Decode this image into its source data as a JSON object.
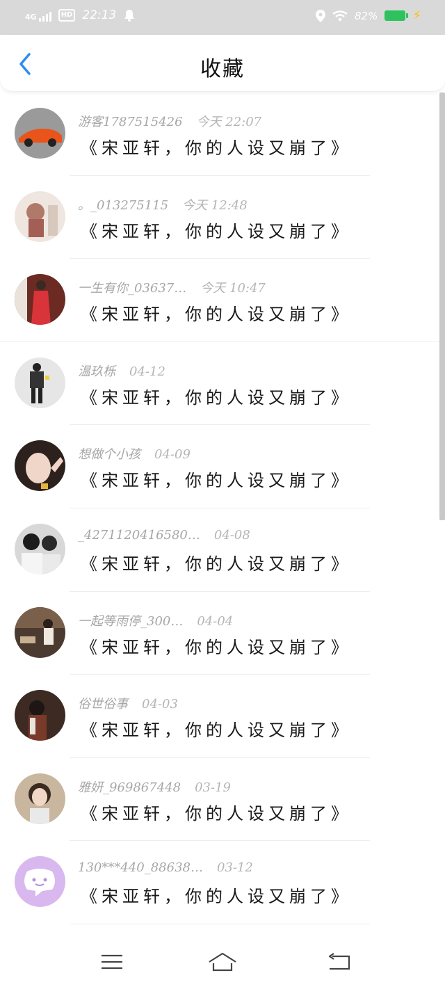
{
  "status_bar": {
    "network": "4G",
    "hd": "HD",
    "time": "22:13",
    "battery": "82%"
  },
  "header": {
    "title": "收藏"
  },
  "items": [
    {
      "user": "游客1787515426",
      "time": "今天 22:07",
      "content": "《宋亚轩，你的人设又崩了》",
      "avatar_color": "#7a7a7a"
    },
    {
      "user": "。_013275115",
      "time": "今天 12:48",
      "content": "《宋亚轩，你的人设又崩了》",
      "avatar_color": "#e6d8cf"
    },
    {
      "user": "一生有你_03637…",
      "time": "今天 10:47",
      "content": "《宋亚轩，你的人设又崩了》",
      "avatar_color": "#7b2a22"
    },
    {
      "user": "温玖栎",
      "time": "04-12",
      "content": "《宋亚轩，你的人设又崩了》",
      "avatar_color": "#e4e4e4"
    },
    {
      "user": "想做个小孩",
      "time": "04-09",
      "content": "《宋亚轩，你的人设又崩了》",
      "avatar_color": "#3a2a24"
    },
    {
      "user": "_4271120416580…",
      "time": "04-08",
      "content": "《宋亚轩，你的人设又崩了》",
      "avatar_color": "#cfcfcf"
    },
    {
      "user": "一起等雨停_300…",
      "time": "04-04",
      "content": "《宋亚轩，你的人设又崩了》",
      "avatar_color": "#4a3a30"
    },
    {
      "user": "俗世俗事",
      "time": "04-03",
      "content": "《宋亚轩，你的人设又崩了》",
      "avatar_color": "#5a3528"
    },
    {
      "user": "雅妍_969867448",
      "time": "03-19",
      "content": "《宋亚轩，你的人设又崩了》",
      "avatar_color": "#c8b59e"
    },
    {
      "user": "130***440_88638…",
      "time": "03-12",
      "content": "《宋亚轩，你的人设又崩了》",
      "avatar_color": "#d8b8ee"
    }
  ],
  "colors": {
    "accent": "#2b8ef0",
    "status_bar_bg": "#d9d9d9",
    "meta_text": "#a7a7a7"
  },
  "nav": {
    "icons": [
      "menu-icon",
      "home-icon",
      "back-icon"
    ]
  }
}
